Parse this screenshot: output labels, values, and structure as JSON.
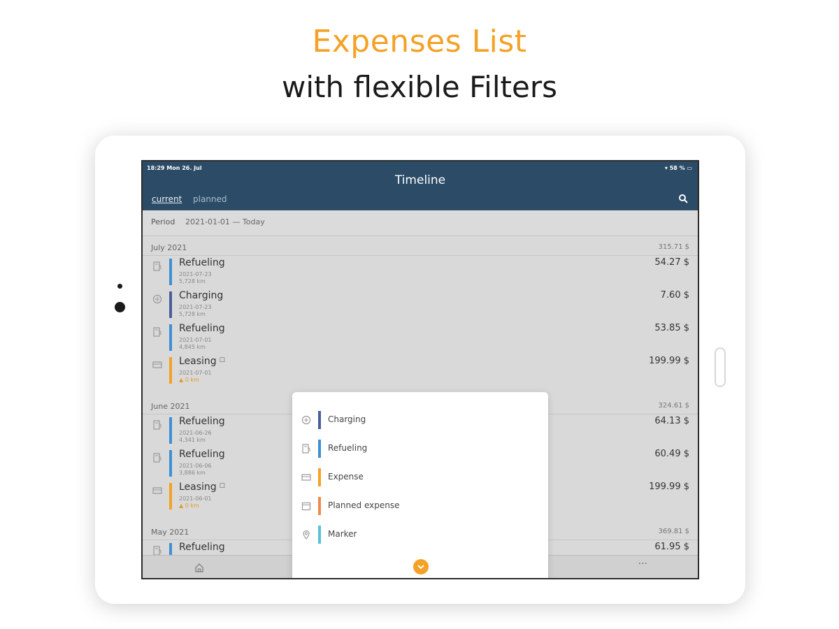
{
  "headline": "Expenses List",
  "subheadline": "with flexible Filters",
  "status": {
    "time": "18:29  Mon 26. Jul",
    "battery": "▾ 58 % ▭"
  },
  "app": {
    "title": "Timeline",
    "tabs": [
      {
        "label": "current",
        "active": true
      },
      {
        "label": "planned",
        "active": false
      }
    ]
  },
  "period": {
    "label": "Period",
    "value": "2021-01-01 — Today"
  },
  "months": [
    {
      "name": "July 2021",
      "total": "315.71 $",
      "entries": [
        {
          "title": "Refueling",
          "date": "2021-07-23",
          "sub": "5,728 km",
          "amount": "54.27 $",
          "icon": "fuel-icon",
          "color": "#3d8fd6"
        },
        {
          "title": "Charging",
          "date": "2021-07-23",
          "sub": "5,728 km",
          "amount": "7.60 $",
          "icon": "charging-icon",
          "color": "#4a5f99"
        },
        {
          "title": "Refueling",
          "date": "2021-07-01",
          "sub": "4,845 km",
          "amount": "53.85 $",
          "icon": "fuel-icon",
          "color": "#3d8fd6"
        },
        {
          "title": "Leasing",
          "date": "2021-07-01",
          "sub": "0 km",
          "amount": "199.99 $",
          "icon": "card-icon",
          "color": "#f5a125",
          "locked": true,
          "warning": true
        }
      ]
    },
    {
      "name": "June 2021",
      "total": "324.61 $",
      "entries": [
        {
          "title": "Refueling",
          "date": "2021-06-26",
          "sub": "4,341 km",
          "amount": "64.13 $",
          "icon": "fuel-icon",
          "color": "#3d8fd6"
        },
        {
          "title": "Refueling",
          "date": "2021-06-06",
          "sub": "3,886 km",
          "amount": "60.49 $",
          "icon": "fuel-icon",
          "color": "#3d8fd6"
        },
        {
          "title": "Leasing",
          "date": "2021-06-01",
          "sub": "0 km",
          "amount": "199.99 $",
          "icon": "card-icon",
          "color": "#f5a125",
          "locked": true,
          "warning": true
        }
      ]
    },
    {
      "name": "May 2021",
      "total": "369.81 $",
      "entries": [
        {
          "title": "Refueling",
          "amount": "61.95 $",
          "icon": "fuel-icon",
          "color": "#3d8fd6"
        }
      ]
    }
  ],
  "filter_menu": {
    "options": [
      {
        "label": "Charging",
        "icon": "charging-icon",
        "color": "#4a5f99"
      },
      {
        "label": "Refueling",
        "icon": "fuel-icon",
        "color": "#3d8fd6"
      },
      {
        "label": "Expense",
        "icon": "card-icon",
        "color": "#f5a125"
      },
      {
        "label": "Planned expense",
        "icon": "calendar-icon",
        "color": "#f08a4b"
      },
      {
        "label": "Marker",
        "icon": "map-pin-icon",
        "color": "#5bc0d6"
      }
    ]
  },
  "tabbar": {
    "more": "···"
  },
  "warning_symbol": "▲",
  "lock_symbol": "☐"
}
